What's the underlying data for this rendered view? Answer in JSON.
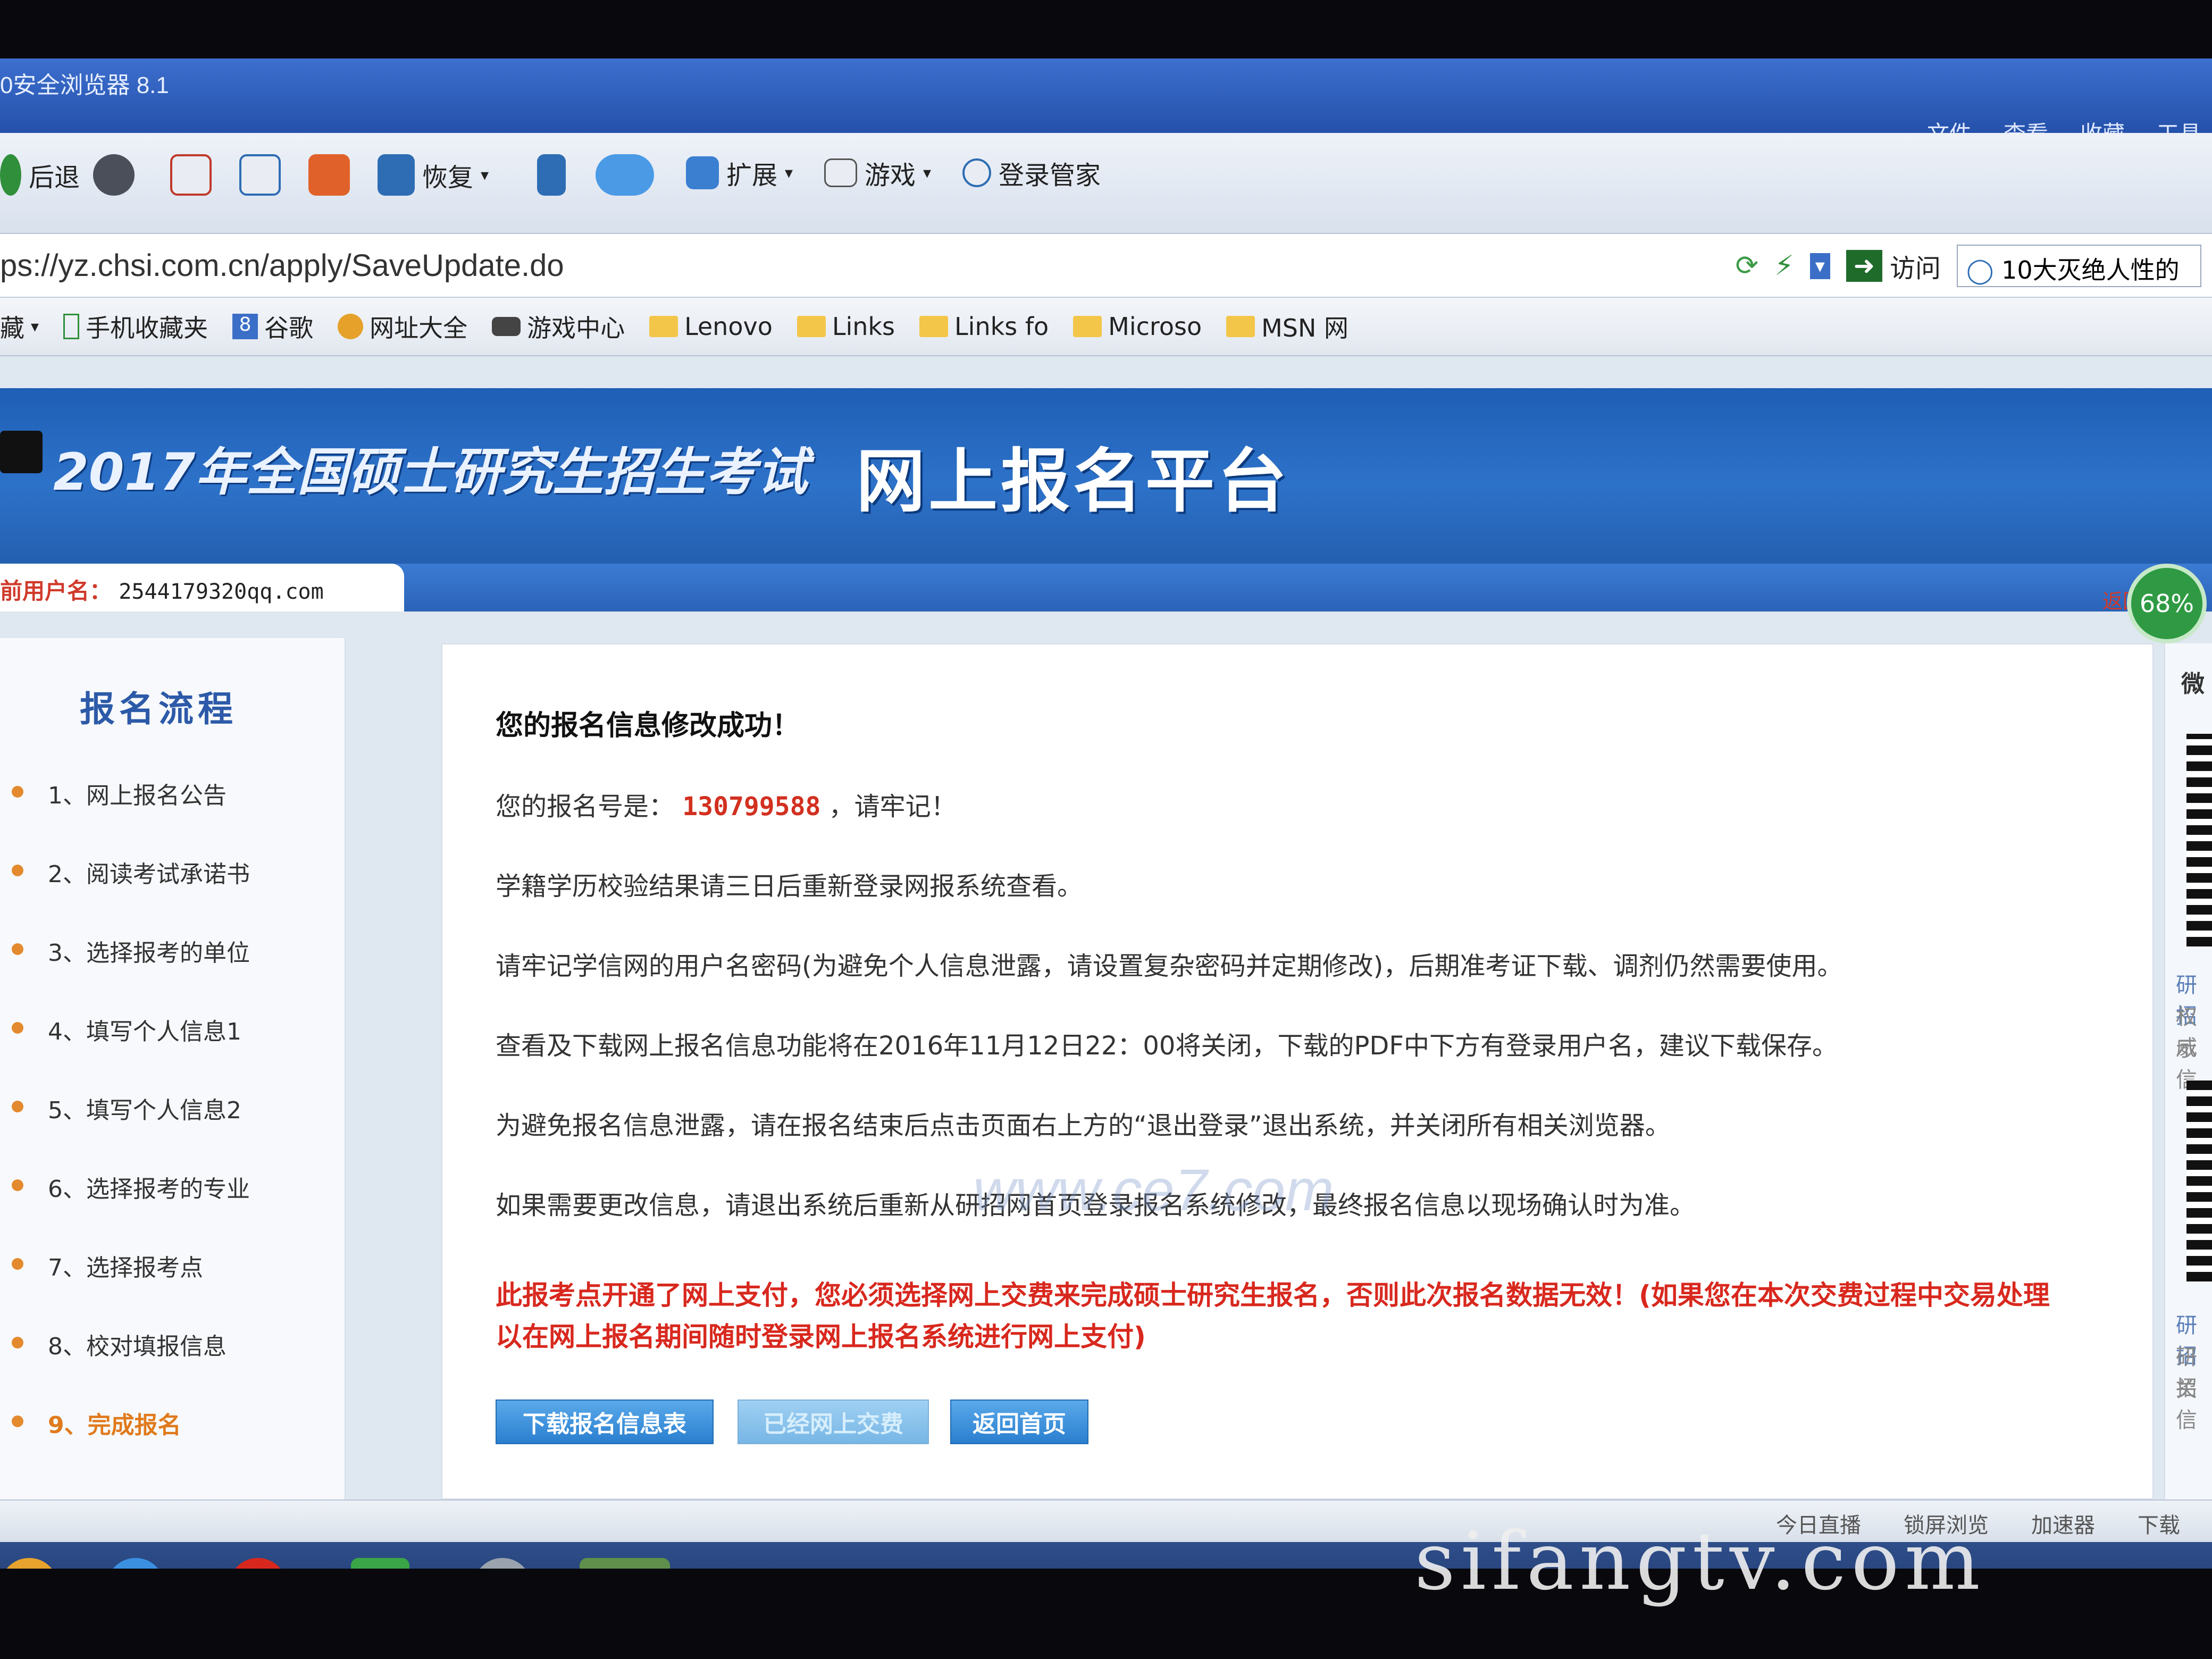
{
  "browser": {
    "title": "0安全浏览器 8.1",
    "menus": [
      "文件",
      "查看",
      "收藏",
      "工具"
    ],
    "toolbar": {
      "back": "后退",
      "restore": "恢复",
      "extensions": "扩展",
      "games": "游戏",
      "login_manager": "登录管家"
    },
    "address": "ps://yz.chsi.com.cn/apply/SaveUpdate.do",
    "visit": "访问",
    "search_text": "10大灭绝人性的",
    "bookmarks": [
      "藏",
      "手机收藏夹",
      "谷歌",
      "网址大全",
      "游戏中心",
      "Lenovo",
      "Links",
      "Links fo",
      "Microso",
      "MSN 网"
    ]
  },
  "banner": {
    "exam_title": "2017年全国硕士研究生招生考试",
    "platform_title": "网上报名平台"
  },
  "user": {
    "label": "前用户名：",
    "value": "2544179320qq.com",
    "return": "返回"
  },
  "progress_badge": "68%",
  "sidebar": {
    "title": "报名流程",
    "steps": [
      "1、网上报名公告",
      "2、阅读考试承诺书",
      "3、选择报考的单位",
      "4、填写个人信息1",
      "5、填写个人信息2",
      "6、选择报考的专业",
      "7、选择报考点",
      "8、校对填报信息",
      "9、完成报名"
    ]
  },
  "content": {
    "success_title": "您的报名信息修改成功！",
    "regnum_prefix": "您的报名号是：",
    "regnum": "130799588",
    "regnum_suffix": "，请牢记！",
    "line_xueji": "学籍学历校验结果请三日后重新登录网报系统查看。",
    "line_password": "请牢记学信网的用户名密码(为避免个人信息泄露，请设置复杂密码并定期修改)，后期准考证下载、调剂仍然需要使用。",
    "line_download": "查看及下载网上报名信息功能将在2016年11月12日22：00将关闭，下载的PDF中下方有登录用户名，建议下载保存。",
    "line_logout": "为避免报名信息泄露，请在报名结束后点击页面右上方的“退出登录”退出系统，并关闭所有相关浏览器。",
    "line_modify": "如果需要更改信息，请退出系统后重新从研招网首页登录报名系统修改，最终报名信息以现场确认时为准。",
    "warning_line1": "此报考点开通了网上支付，您必须选择网上交费来完成硕士研究生报名，否则此次报名数据无效！(如果您在本次交费过程中交易处理",
    "warning_line2": "以在网上报名期间随时登录网上报名系统进行网上支付)",
    "btn_download": "下载报名信息表",
    "btn_paid": "已经网上交费",
    "btn_home": "返回首页",
    "watermark": "www.ce7.com"
  },
  "right_panel": {
    "label": "微",
    "texts": [
      "研招",
      "权威",
      "示信",
      "研招",
      "研招",
      "关信"
    ]
  },
  "statusbar": [
    "今日直播",
    "锁屏浏览",
    "加速器",
    "下载"
  ],
  "photo_watermark": "sifangtv.com"
}
